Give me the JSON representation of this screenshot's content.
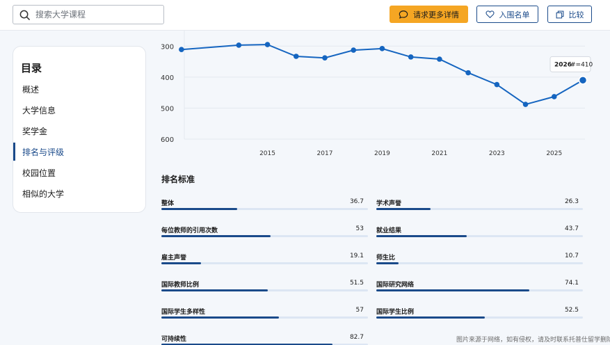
{
  "header": {
    "search_placeholder": "搜索大学课程",
    "request_label": "请求更多详情",
    "shortlist_label": "入围名单",
    "compare_label": "比较"
  },
  "toc": {
    "title": "目录",
    "items": [
      {
        "label": "概述",
        "active": false
      },
      {
        "label": "大学信息",
        "active": false
      },
      {
        "label": "奖学金",
        "active": false
      },
      {
        "label": "排名与评级",
        "active": true
      },
      {
        "label": "校园位置",
        "active": false
      },
      {
        "label": "相似的大学",
        "active": false
      }
    ]
  },
  "chart_data": {
    "type": "line",
    "x": [
      2013,
      2015,
      2016,
      2017,
      2018,
      2019,
      2020,
      2021,
      2022,
      2023,
      2024,
      2025,
      2026
    ],
    "y": [
      311,
      297,
      295,
      333,
      338,
      313,
      308,
      335,
      342,
      386,
      424,
      488,
      463,
      410
    ],
    "x_full": [
      2013,
      2014,
      2015,
      2016,
      2017,
      2018,
      2019,
      2020,
      2021,
      2022,
      2023,
      2024,
      2025,
      2026
    ],
    "points_x": [
      2012,
      2014,
      2015,
      2016,
      2017,
      2018,
      2019,
      2020,
      2021,
      2022,
      2023,
      2024,
      2025,
      2026
    ],
    "xticks": [
      "2015",
      "2017",
      "2019",
      "2021",
      "2023",
      "2025"
    ],
    "yticks": [
      "300",
      "400",
      "500",
      "600"
    ],
    "ylim": [
      600,
      250
    ],
    "y_inverted": true,
    "grid": true,
    "tooltip": {
      "year": "2026",
      "text": "#=410"
    },
    "line_color": "#1565c0"
  },
  "criteria": {
    "title": "排名标准",
    "metrics": [
      {
        "name": "整体",
        "value": "36.7",
        "fraction": 0.367
      },
      {
        "name": "学术声誉",
        "value": "26.3",
        "fraction": 0.263
      },
      {
        "name": "每位教师的引用次数",
        "value": "53",
        "fraction": 0.53
      },
      {
        "name": "就业结果",
        "value": "43.7",
        "fraction": 0.437
      },
      {
        "name": "雇主声誉",
        "value": "19.1",
        "fraction": 0.191
      },
      {
        "name": "师生比",
        "value": "10.7",
        "fraction": 0.107
      },
      {
        "name": "国际教师比例",
        "value": "51.5",
        "fraction": 0.515
      },
      {
        "name": "国际研究网络",
        "value": "74.1",
        "fraction": 0.741
      },
      {
        "name": "国际学生多样性",
        "value": "57",
        "fraction": 0.57
      },
      {
        "name": "国际学生比例",
        "value": "52.5",
        "fraction": 0.525
      },
      {
        "name": "可持续性",
        "value": "82.7",
        "fraction": 0.827
      }
    ]
  },
  "watermark": "图片来源于网络，如有侵权，请及时联系托普仕留学删除"
}
